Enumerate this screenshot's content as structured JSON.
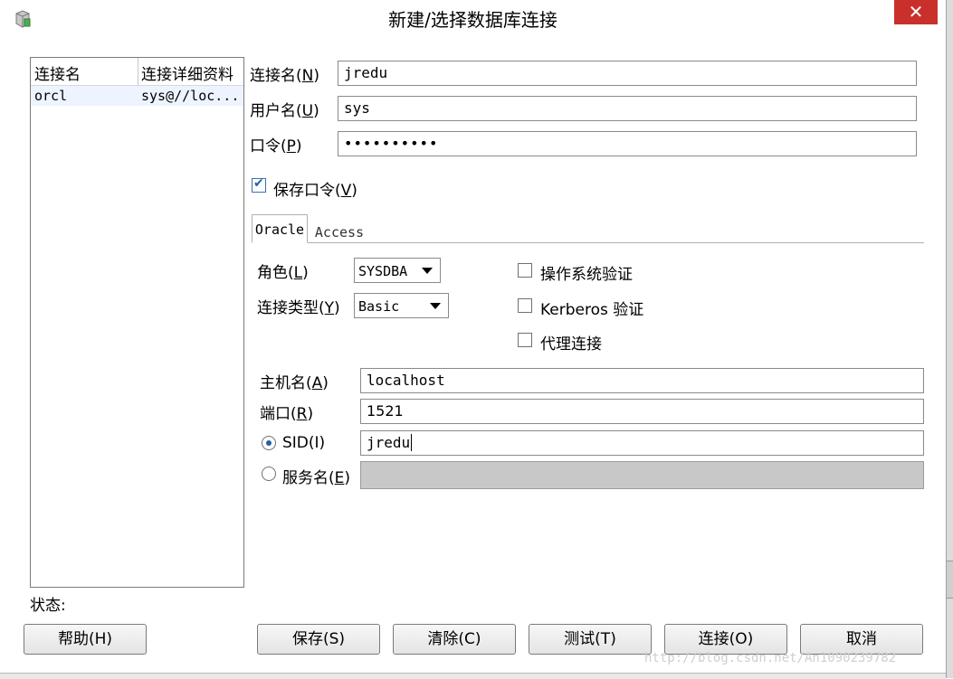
{
  "window": {
    "title": "新建/选择数据库连接",
    "close_glyph": "✕"
  },
  "connection_list": {
    "columns": [
      "连接名",
      "连接详细资料"
    ],
    "rows": [
      {
        "name": "orcl",
        "details": "sys@//loc..."
      }
    ]
  },
  "form": {
    "conn_name_label": "连接名(",
    "conn_name_key": "N",
    "conn_name_value": "jredu",
    "username_label": "用户名(",
    "username_key": "U",
    "username_value": "sys",
    "password_label": "口令(",
    "password_key": "P",
    "password_value": "••••••••••",
    "save_password_label": "保存口令(",
    "save_password_key": "V",
    "save_password_checked": true
  },
  "tabs": [
    "Oracle",
    "Access"
  ],
  "oracle": {
    "role_label": "角色(",
    "role_key": "L",
    "role_value": "SYSDBA",
    "conn_type_label": "连接类型(",
    "conn_type_key": "Y",
    "conn_type_value": "Basic",
    "os_auth_label": "操作系统验证",
    "kerberos_label": "Kerberos 验证",
    "proxy_label": "代理连接",
    "host_label": "主机名(",
    "host_key": "A",
    "host_value": "localhost",
    "port_label": "端口(",
    "port_key": "R",
    "port_value": "1521",
    "sid_label": "SID(I)",
    "sid_value": "jredu",
    "service_label": "服务名(",
    "service_key": "E",
    "service_value": ""
  },
  "status_label": "状态:",
  "buttons": {
    "help": "帮助(H)",
    "save": "保存(S)",
    "clear": "清除(C)",
    "test": "测试(T)",
    "connect": "连接(O)",
    "cancel": "取消"
  },
  "watermark": "http://blog.csdn.net/An1090239782"
}
